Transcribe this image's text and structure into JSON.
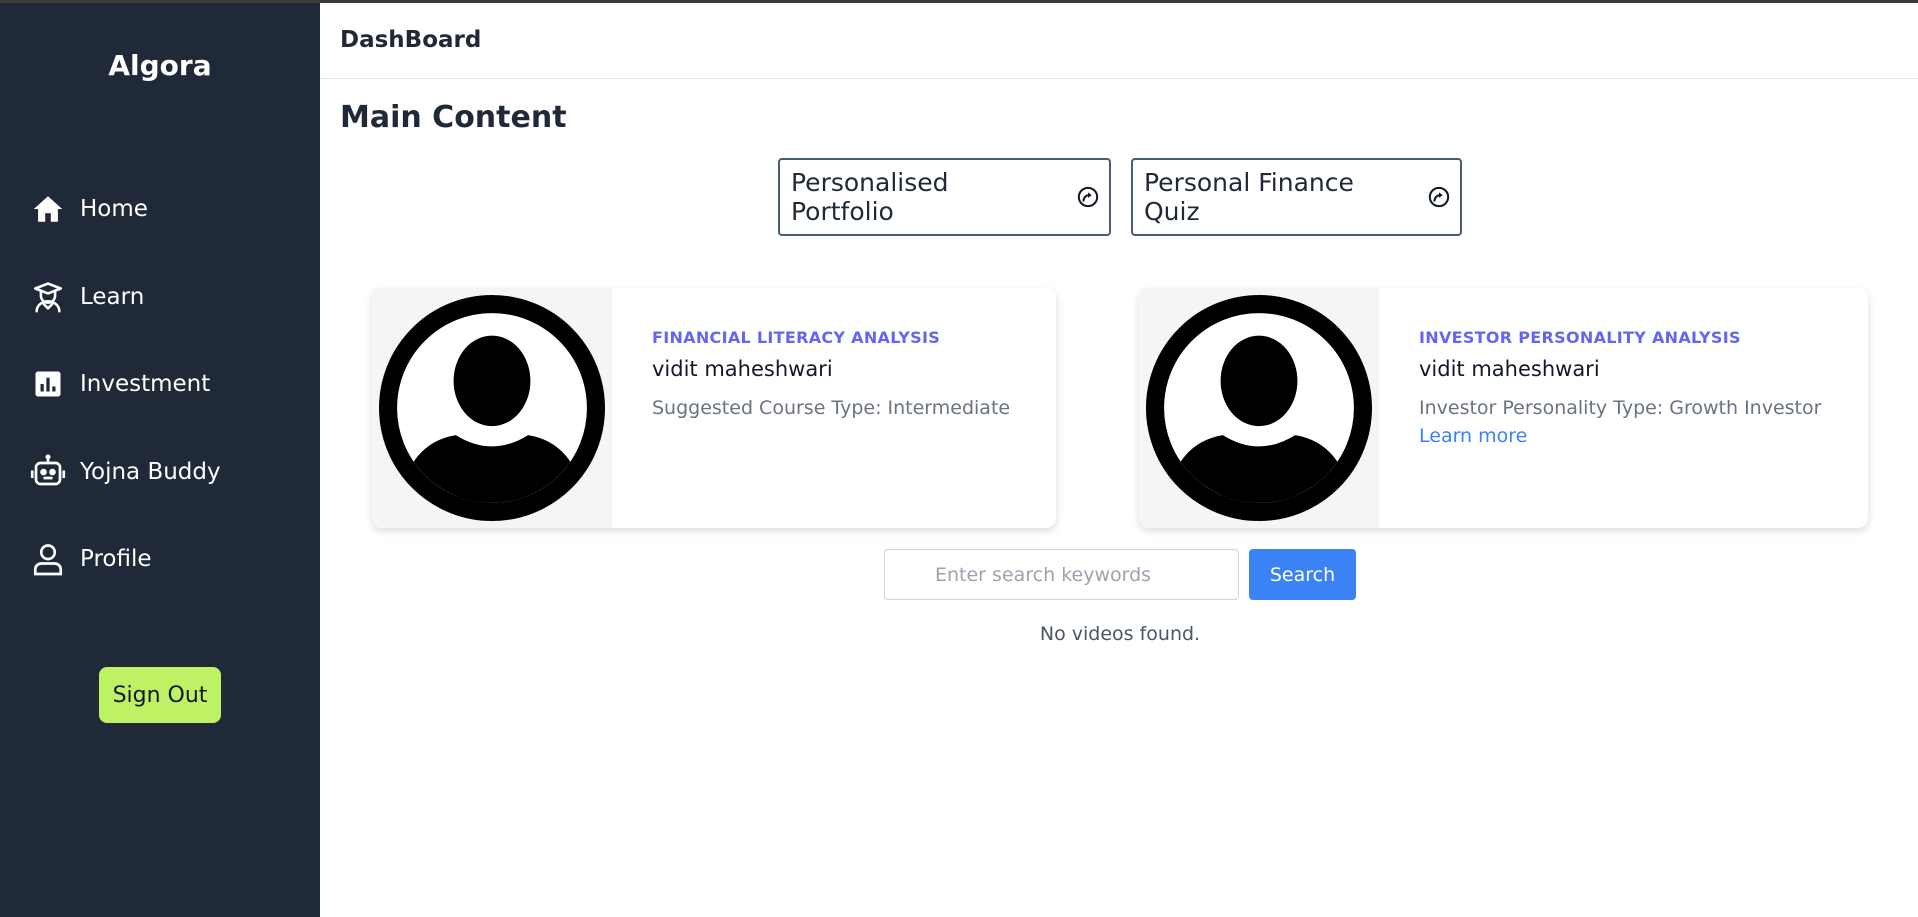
{
  "sidebar": {
    "brand": "Algora",
    "items": [
      {
        "label": "Home",
        "icon": "home-icon"
      },
      {
        "label": "Learn",
        "icon": "graduation-icon"
      },
      {
        "label": "Investment",
        "icon": "chart-icon"
      },
      {
        "label": "Yojna Buddy",
        "icon": "robot-icon"
      },
      {
        "label": "Profile",
        "icon": "user-icon"
      }
    ],
    "signout_label": "Sign Out",
    "colors": {
      "background": "#1f2937",
      "signout": "#bef264"
    }
  },
  "header": {
    "title": "DashBoard"
  },
  "main": {
    "title": "Main Content",
    "quick_buttons": [
      {
        "label": "Personalised Portfolio",
        "icon": "arrow-circle-icon"
      },
      {
        "label": "Personal Finance Quiz",
        "icon": "arrow-circle-icon"
      }
    ],
    "cards": [
      {
        "kicker": "FINANCIAL LITERACY ANALYSIS",
        "name": "vidit maheshwari",
        "description": "Suggested Course Type: Intermediate",
        "link": ""
      },
      {
        "kicker": "INVESTOR PERSONALITY ANALYSIS",
        "name": "vidit maheshwari",
        "description": "Investor Personality Type: Growth Investor",
        "link": "Learn more"
      }
    ],
    "search": {
      "placeholder": "Enter search keywords",
      "value": "",
      "button_label": "Search"
    },
    "empty_message": "No videos found.",
    "colors": {
      "accent": "#6366f1",
      "primary": "#3b82f6",
      "link": "#3b82f6"
    }
  }
}
